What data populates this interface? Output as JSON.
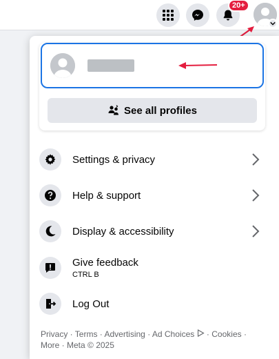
{
  "topbar": {
    "notification_badge": "20+",
    "icons": [
      "menu-grid-icon",
      "messenger-icon",
      "bell-icon",
      "account-avatar"
    ]
  },
  "profile_card": {
    "see_all_label": "See all profiles"
  },
  "menu_items": [
    {
      "label": "Settings & privacy",
      "icon": "gear-icon",
      "has_chevron": true
    },
    {
      "label": "Help & support",
      "icon": "question-icon",
      "has_chevron": true
    },
    {
      "label": "Display & accessibility",
      "icon": "moon-icon",
      "has_chevron": true
    },
    {
      "label": "Give feedback",
      "sub": "CTRL B",
      "icon": "feedback-icon",
      "has_chevron": false
    },
    {
      "label": "Log Out",
      "icon": "logout-icon",
      "has_chevron": false
    }
  ],
  "footer": {
    "privacy": "Privacy",
    "terms": "Terms",
    "advertising": "Advertising",
    "ad_choices": "Ad Choices",
    "cookies": "Cookies",
    "more": "More",
    "copyright": "Meta © 2025"
  },
  "colors": {
    "accent": "#1b74e4",
    "annotation_arrow": "#e41e3f",
    "badge": "#e41e3f"
  }
}
